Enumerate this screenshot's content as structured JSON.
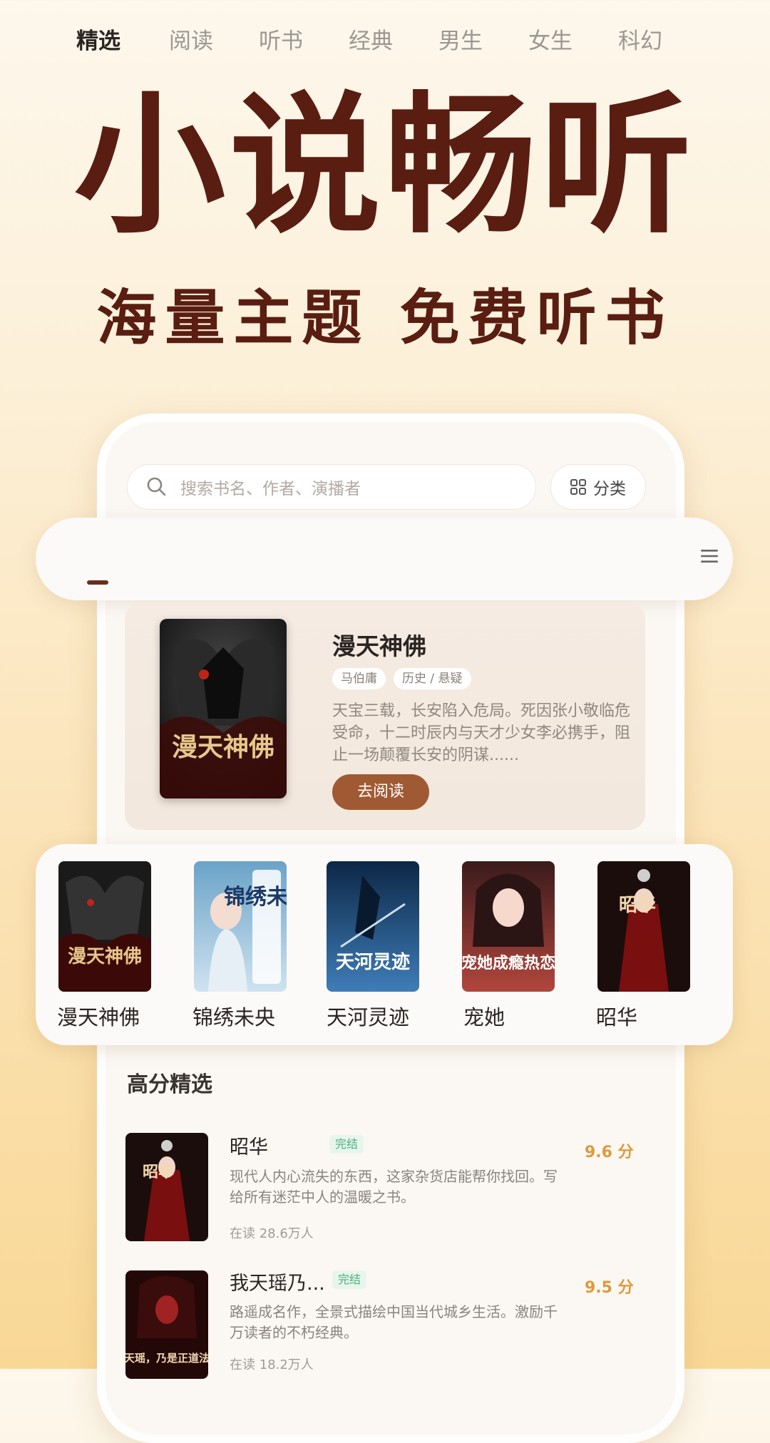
{
  "hero": {
    "title": "小说畅听",
    "subtitle": "海量主题 免费听书"
  },
  "search": {
    "placeholder": "搜索书名、作者、演播者",
    "category_label": "分类"
  },
  "tabs": [
    "精选",
    "阅读",
    "听书",
    "经典",
    "男生",
    "女生",
    "科幻"
  ],
  "feature": {
    "title": "漫天神佛",
    "author": "马伯庸",
    "genre": "历史 / 悬疑",
    "desc": "天宝三载，长安陷入危局。死因张小敬临危受命，十二时辰内与天才少女李必携手，阻止一场颠覆长安的阴谋......",
    "button": "去阅读",
    "cover_text": "漫天神佛"
  },
  "shelf": [
    {
      "title": "漫天神佛",
      "cover_text": "漫天神佛"
    },
    {
      "title": "锦绣未央",
      "cover_text": "锦绣未央"
    },
    {
      "title": "天河灵迹",
      "cover_text": "天河灵迹"
    },
    {
      "title": "宠她",
      "cover_text": "宠她成瘾热恋"
    },
    {
      "title": "昭华",
      "cover_text": "昭华"
    }
  ],
  "section": {
    "title": "高分精选"
  },
  "list": [
    {
      "title": "昭华",
      "status": "完结",
      "desc": "现代人内心流失的东西，这家杂货店能帮你找回。写给所有迷茫中人的温暖之书。",
      "reading": "在读 28.6万人",
      "score": "9.6 分",
      "cover_text": "昭华"
    },
    {
      "title": "我天瑶乃...",
      "status": "完结",
      "desc": "路遥成名作，全景式描绘中国当代城乡生活。激励千万读者的不朽经典。",
      "reading": "在读 18.2万人",
      "score": "9.5 分",
      "cover_text": "我天瑶，乃是正道法门"
    }
  ],
  "colors": {
    "brand_dark": "#5a1d12",
    "button_brown": "#a05a33",
    "score_orange": "#e09a3a",
    "done_green": "#4ab07a"
  }
}
